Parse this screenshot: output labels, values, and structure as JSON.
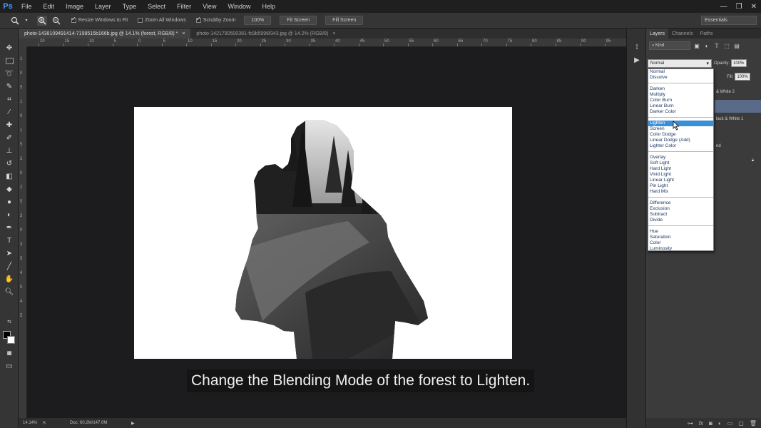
{
  "app": {
    "logo": "Ps"
  },
  "menu": [
    "File",
    "Edit",
    "Image",
    "Layer",
    "Type",
    "Select",
    "Filter",
    "View",
    "Window",
    "Help"
  ],
  "window_controls": {
    "minimize": "—",
    "restore": "❐",
    "close": "✕"
  },
  "options": {
    "resize_windows": "Resize Windows to Fit",
    "zoom_all": "Zoom All Windows",
    "scrubby_zoom": "Scrubby Zoom",
    "btn_100": "100%",
    "btn_fit": "Fit Screen",
    "btn_fill": "Fill Screen",
    "workspace": "Essentials"
  },
  "tabs": [
    {
      "label": "photo-1438109491414-7198515b166b.jpg @ 14.1% (forest, RGB/8) *",
      "close": "×"
    },
    {
      "label": "photo-1421790500381-fc9b5996f343.jpg @ 14.2% (RGB/8)",
      "close": "×"
    }
  ],
  "ruler": {
    "h_ticks": [
      "20",
      "15",
      "10",
      "5",
      "0",
      "5",
      "10",
      "15",
      "20",
      "25",
      "30",
      "35",
      "40",
      "45",
      "50",
      "55",
      "60",
      "65",
      "70",
      "75",
      "80",
      "85",
      "90",
      "95"
    ],
    "v_ticks": [
      "1",
      "0",
      "5",
      "1",
      "0",
      "1",
      "5",
      "2",
      "0",
      "2",
      "5",
      "3",
      "0",
      "3",
      "5",
      "4",
      "0",
      "4",
      "5"
    ]
  },
  "subtitle": "Change the Blending Mode of the forest to Lighten.",
  "status": {
    "zoom": "14.14%",
    "doc": "Doc: 60.2M/147.0M"
  },
  "layers_panel": {
    "tabs": [
      "Layers",
      "Channels",
      "Paths"
    ],
    "kind": "Kind",
    "blend_mode": "Normal",
    "opacity_label": "Opacity:",
    "opacity_value": "100%",
    "fill_label": "Fill:",
    "fill_value": "100%",
    "layers": [
      "& White 2",
      "lack & White 1",
      "nd"
    ]
  },
  "blend_menu": {
    "groups": [
      [
        "Normal",
        "Dissolve"
      ],
      [
        "Darken",
        "Multiply",
        "Color Burn",
        "Linear Burn",
        "Darker Color"
      ],
      [
        "Lighten",
        "Screen",
        "Color Dodge",
        "Linear Dodge (Add)",
        "Lighter Color"
      ],
      [
        "Overlay",
        "Soft Light",
        "Hard Light",
        "Vivid Light",
        "Linear Light",
        "Pin Light",
        "Hard Mix"
      ],
      [
        "Difference",
        "Exclusion",
        "Subtract",
        "Divide"
      ],
      [
        "Hue",
        "Saturation",
        "Color",
        "Luminosity"
      ]
    ],
    "selected": "Lighten"
  },
  "colors": {
    "selection": "#3b8fd8",
    "ps_blue": "#3ea0ff"
  }
}
